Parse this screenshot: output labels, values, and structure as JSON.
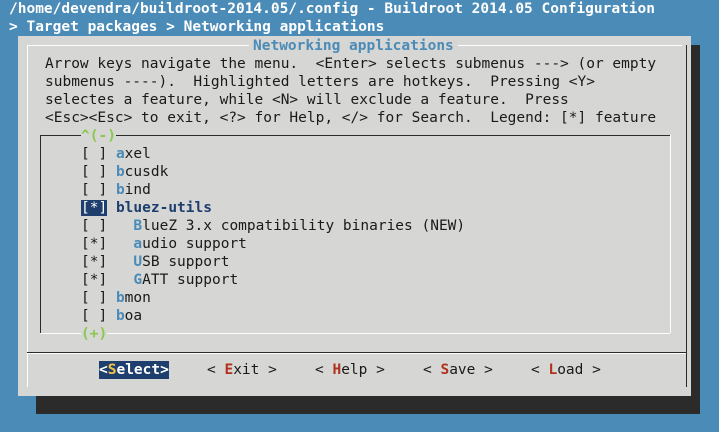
{
  "backtitle": "/home/devendra/buildroot-2014.05/.config - Buildroot 2014.05 Configuration",
  "breadcrumb": "> Target packages > Networking applications",
  "dialog": {
    "title": "Networking applications",
    "help_lines": [
      "Arrow keys navigate the menu.  <Enter> selects submenus ---> (or empty",
      "submenus ----).  Highlighted letters are hotkeys.  Pressing <Y>",
      "selectes a feature, while <N> will exclude a feature.  Press",
      "<Esc><Esc> to exit, <?> for Help, </> for Search.  Legend: [*] feature"
    ],
    "scroll_up": "^(-)",
    "scroll_down": "(+)"
  },
  "menu": {
    "items": [
      {
        "box": "[ ]",
        "hotkey": "a",
        "rest": "xel"
      },
      {
        "box": "[ ]",
        "hotkey": "b",
        "rest": "cusdk"
      },
      {
        "box": "[ ]",
        "hotkey": "b",
        "rest": "ind"
      },
      {
        "box": "[*]",
        "hotkey": "b",
        "rest": "luez-utils",
        "selected": true
      },
      {
        "box": "[ ]",
        "hotkey": "B",
        "rest": "lueZ 3.x compatibility binaries (NEW)",
        "indent": true
      },
      {
        "box": "[*]",
        "hotkey": "a",
        "rest": "udio support",
        "indent": true
      },
      {
        "box": "[*]",
        "hotkey": "U",
        "rest": "SB support",
        "indent": true
      },
      {
        "box": "[*]",
        "hotkey": "G",
        "rest": "ATT support",
        "indent": true
      },
      {
        "box": "[ ]",
        "hotkey": "b",
        "rest": "mon"
      },
      {
        "box": "[ ]",
        "hotkey": "b",
        "rest": "oa"
      }
    ]
  },
  "buttons": {
    "select": {
      "pre": "<",
      "hotkey": "S",
      "rest": "elect>"
    },
    "exit": {
      "pre": "< ",
      "hotkey": "E",
      "rest": "xit >"
    },
    "help": {
      "pre": "< ",
      "hotkey": "H",
      "rest": "elp >"
    },
    "save": {
      "pre": "< ",
      "hotkey": "S",
      "rest": "ave >"
    },
    "load": {
      "pre": "< ",
      "hotkey": "L",
      "rest": "oad >"
    }
  },
  "colors": {
    "background": "#4a8bb7",
    "dialog": "#d6d6d4",
    "selection": "#1e3f6e",
    "hotkey": "#4a8bb7",
    "button_hotkey": "#b0321e",
    "scroll_indicator": "#88c84a"
  }
}
